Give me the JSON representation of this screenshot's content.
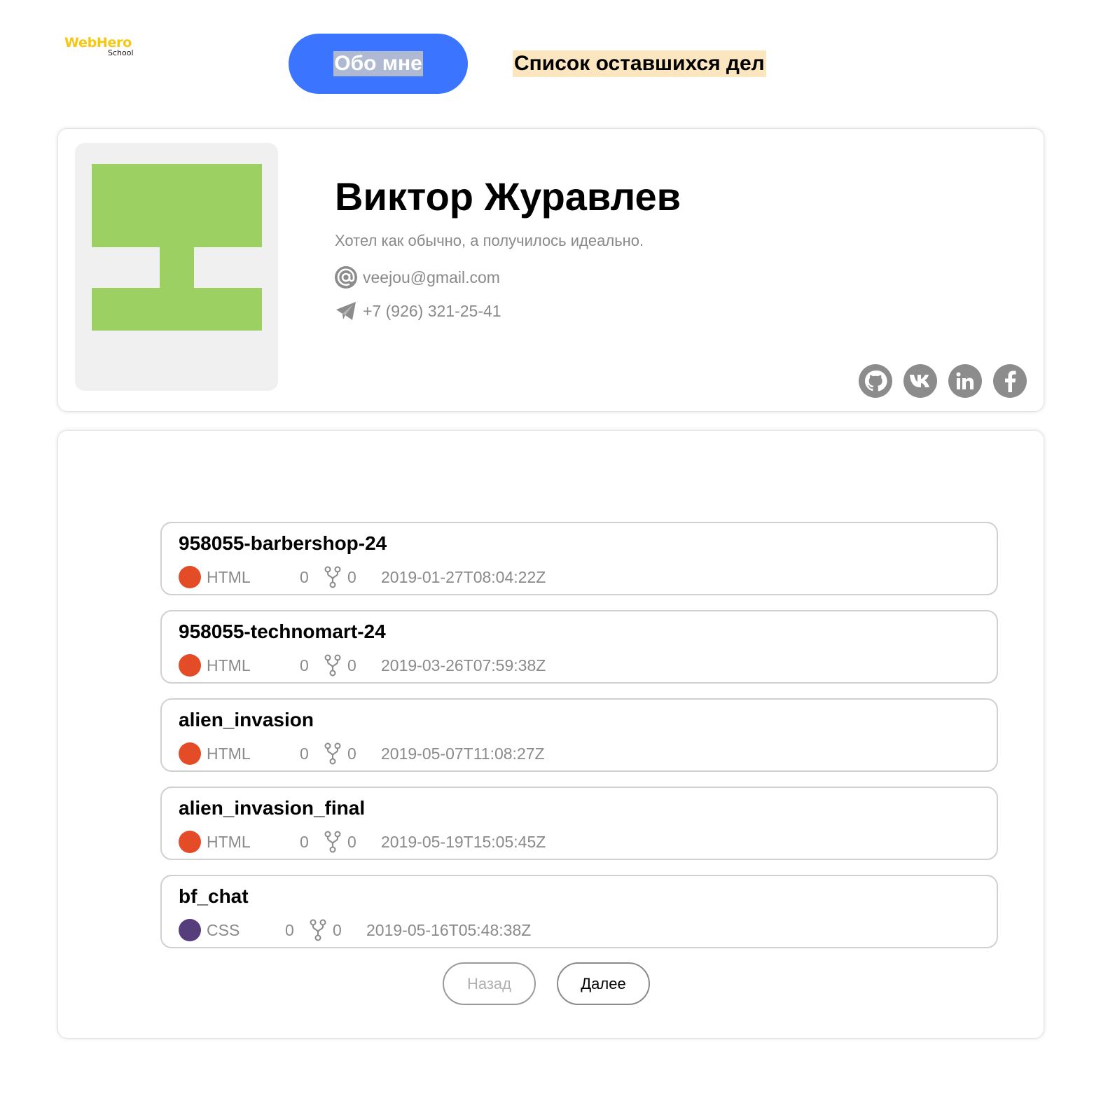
{
  "header": {
    "logo_main": "WebHero",
    "logo_sub": "School",
    "nav_about": "Обо мне",
    "nav_todo": "Список оставшихся дел"
  },
  "profile": {
    "name": "Виктор Журавлев",
    "bio": "Хотел как обычно, а получилось идеально.",
    "email": "veejou@gmail.com",
    "phone": "+7 (926) 321-25-41",
    "socials": [
      "github-icon",
      "vk-icon",
      "linkedin-icon",
      "facebook-icon"
    ]
  },
  "repos": [
    {
      "name": "958055-barbershop-24",
      "language": "HTML",
      "lang_color": "#E34C26",
      "stars": "0",
      "forks": "0",
      "updated": "2019-01-27T08:04:22Z"
    },
    {
      "name": "958055-technomart-24",
      "language": "HTML",
      "lang_color": "#E34C26",
      "stars": "0",
      "forks": "0",
      "updated": "2019-03-26T07:59:38Z"
    },
    {
      "name": "alien_invasion",
      "language": "HTML",
      "lang_color": "#E34C26",
      "stars": "0",
      "forks": "0",
      "updated": "2019-05-07T11:08:27Z"
    },
    {
      "name": "alien_invasion_final",
      "language": "HTML",
      "lang_color": "#E34C26",
      "stars": "0",
      "forks": "0",
      "updated": "2019-05-19T15:05:45Z"
    },
    {
      "name": "bf_chat",
      "language": "CSS",
      "lang_color": "#563D7C",
      "stars": "0",
      "forks": "0",
      "updated": "2019-05-16T05:48:38Z"
    }
  ],
  "pagination": {
    "prev": "Назад",
    "next": "Далее"
  },
  "colors": {
    "accent": "#3A74FF",
    "avatar_green": "#9DD062",
    "todo_highlight": "#FCE6BF",
    "muted_text": "#8a8a8a"
  }
}
